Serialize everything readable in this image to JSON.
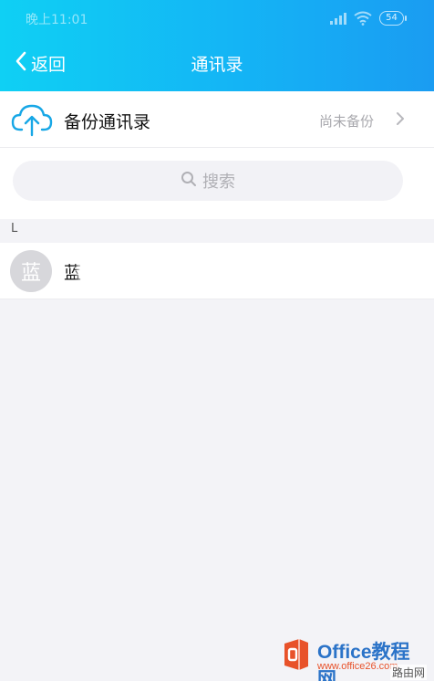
{
  "status_bar": {
    "time": "晚上11:01",
    "battery": "54"
  },
  "nav": {
    "back_label": "返回",
    "title": "通讯录"
  },
  "backup": {
    "title": "备份通讯录",
    "status": "尚未备份"
  },
  "search": {
    "placeholder": "搜索"
  },
  "contacts": {
    "section_letter": "L",
    "items": [
      {
        "avatar_char": "蓝",
        "name": "蓝"
      }
    ]
  },
  "watermark": {
    "brand": "Office教程网",
    "url": "www.office26.com",
    "extra": "路由网"
  },
  "colors": {
    "header_gradient_start": "#0fd0f4",
    "header_gradient_end": "#1a9cf2",
    "background": "#f3f3f7",
    "secondary_text": "#a8a8ad"
  },
  "icons": {
    "back": "chevron-left-icon",
    "cloud": "cloud-upload-icon",
    "search": "search-icon",
    "chevron": "chevron-right-icon"
  }
}
